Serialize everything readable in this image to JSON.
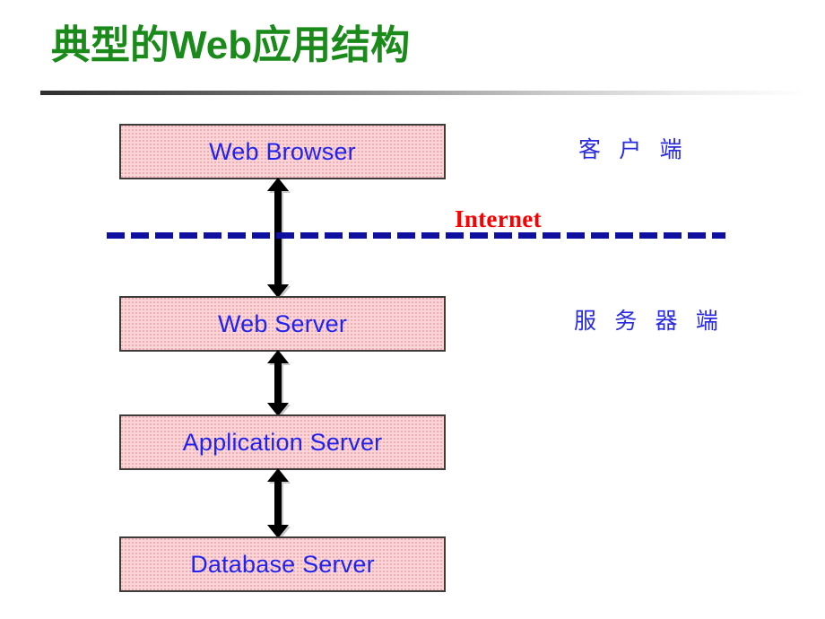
{
  "slide": {
    "title": "典型的Web应用结构",
    "title_color": "#1a8a1a"
  },
  "diagram": {
    "node_fill": "#fad4d6",
    "node_border": "#3f3b38",
    "node_text_color": "#2222ee",
    "nodes": [
      {
        "id": "web-browser",
        "label": "Web Browser"
      },
      {
        "id": "web-server",
        "label": "Web Server"
      },
      {
        "id": "application-server",
        "label": "Application Server"
      },
      {
        "id": "database-server",
        "label": "Database Server"
      }
    ],
    "connectors": [
      {
        "id": "browser-to-web-server",
        "icon": "double-headed-vertical-arrow-icon"
      },
      {
        "id": "web-server-to-app-server",
        "icon": "double-headed-vertical-arrow-icon"
      },
      {
        "id": "app-server-to-database",
        "icon": "double-headed-vertical-arrow-icon"
      }
    ],
    "divider": {
      "label": "Internet",
      "label_color": "#fb0000",
      "line_color": "#0f0fa0",
      "style": "dashed"
    },
    "tiers": [
      {
        "id": "client-side",
        "label": "客 户 端",
        "color": "#2a2ae0"
      },
      {
        "id": "server-side",
        "label": "服 务 器 端",
        "color": "#2a2ae0"
      }
    ]
  }
}
